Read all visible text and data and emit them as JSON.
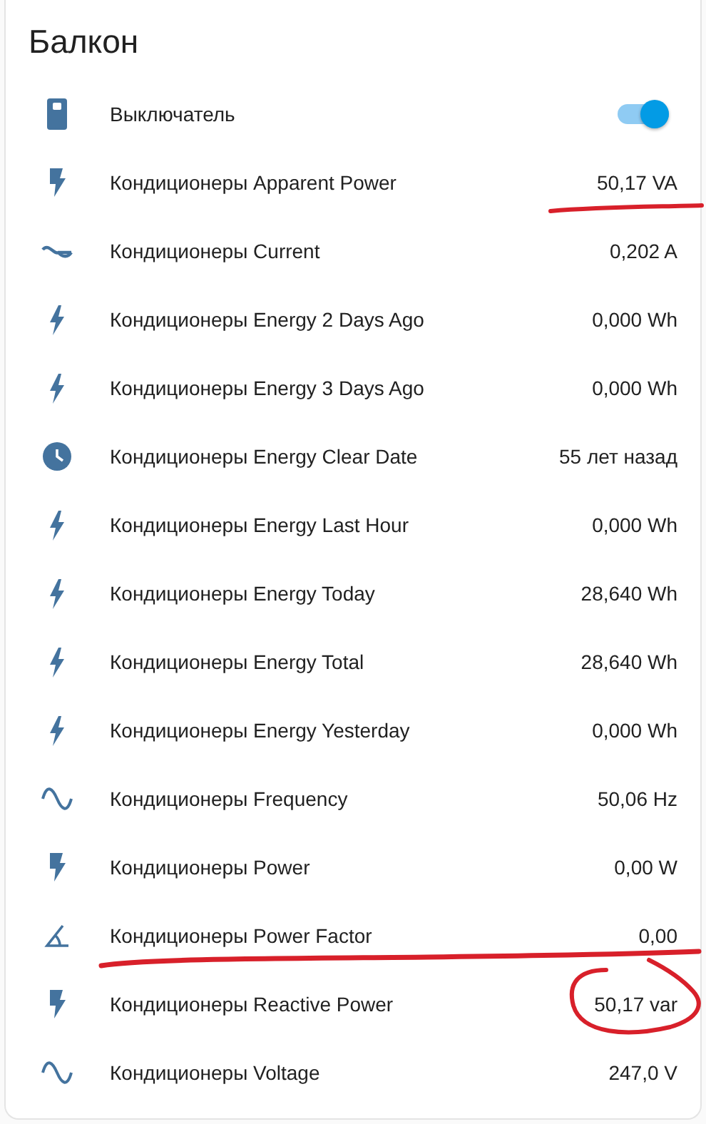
{
  "card": {
    "title": "Балкон",
    "rows": [
      {
        "kind": "switch",
        "name": "Выключатель",
        "on": true
      },
      {
        "kind": "power",
        "name": "Кондиционеры Apparent Power",
        "value": "50,17 VA"
      },
      {
        "kind": "current",
        "name": "Кондиционеры Current",
        "value": "0,202 A"
      },
      {
        "kind": "energy",
        "name": "Кондиционеры Energy 2 Days Ago",
        "value": "0,000 Wh"
      },
      {
        "kind": "energy",
        "name": "Кондиционеры Energy 3 Days Ago",
        "value": "0,000 Wh"
      },
      {
        "kind": "timestamp",
        "name": "Кондиционеры Energy Clear Date",
        "value": "55 лет назад"
      },
      {
        "kind": "energy",
        "name": "Кондиционеры Energy Last Hour",
        "value": "0,000 Wh"
      },
      {
        "kind": "energy",
        "name": "Кондиционеры Energy Today",
        "value": "28,640 Wh"
      },
      {
        "kind": "energy",
        "name": "Кондиционеры Energy Total",
        "value": "28,640 Wh"
      },
      {
        "kind": "energy",
        "name": "Кондиционеры Energy Yesterday",
        "value": "0,000 Wh"
      },
      {
        "kind": "frequency",
        "name": "Кондиционеры Frequency",
        "value": "50,06 Hz"
      },
      {
        "kind": "power",
        "name": "Кондиционеры Power",
        "value": "0,00 W"
      },
      {
        "kind": "power_factor",
        "name": "Кондиционеры Power Factor",
        "value": "0,00"
      },
      {
        "kind": "power",
        "name": "Кондиционеры Reactive Power",
        "value": "50,17 var"
      },
      {
        "kind": "frequency",
        "name": "Кондиционеры Voltage",
        "value": "247,0 V"
      }
    ]
  }
}
